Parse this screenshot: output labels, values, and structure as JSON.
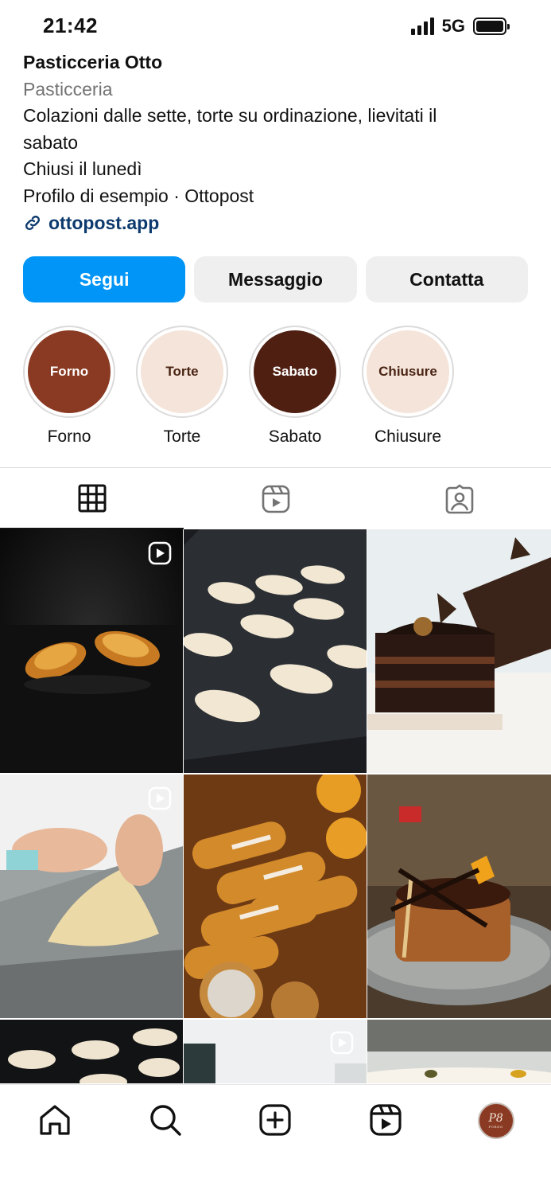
{
  "status_bar": {
    "time": "21:42",
    "network": "5G"
  },
  "profile": {
    "name": "Pasticceria Otto",
    "category": "Pasticceria",
    "bio_lines": [
      "Colazioni dalle sette, torte su ordinazione, lievitati il",
      "sabato",
      "Chiusi il lunedì",
      "Profilo di esempio · Ottopost"
    ],
    "link": "ottopost.app",
    "link_icon": "link-icon"
  },
  "actions": {
    "follow": "Segui",
    "message": "Messaggio",
    "contact": "Contatta"
  },
  "highlights": [
    {
      "title": "Forno",
      "label": "Forno",
      "bg": "#8a3a22",
      "fg": "#ffffff"
    },
    {
      "title": "Torte",
      "label": "Torte",
      "bg": "#f4e4d9",
      "fg": "#4a2414"
    },
    {
      "title": "Sabato",
      "label": "Sabato",
      "bg": "#4f1f12",
      "fg": "#ffffff"
    },
    {
      "title": "Chiusure",
      "label": "Chiusure",
      "bg": "#f4e4d9",
      "fg": "#4a2414"
    }
  ],
  "tabs": [
    "grid-icon",
    "reels-icon",
    "tagged-icon"
  ],
  "posts": [
    {
      "subject": "croissants-on-black",
      "reel": true
    },
    {
      "subject": "raw-croissants-on-tray",
      "reel": false
    },
    {
      "subject": "chocolate-cake-slices",
      "reel": false
    },
    {
      "subject": "kneading-dough",
      "reel": true
    },
    {
      "subject": "eclairs-display",
      "reel": false
    },
    {
      "subject": "chocolate-tartlet",
      "reel": false
    },
    {
      "subject": "croissants-on-tray",
      "reel": false
    },
    {
      "subject": "bakery-scene",
      "reel": true
    },
    {
      "subject": "dessert-plate",
      "reel": false
    }
  ],
  "bottom_nav": [
    "home-icon",
    "search-icon",
    "create-icon",
    "reels-icon",
    "profile-avatar"
  ],
  "avatar": {
    "initials": "P8",
    "sub": "FORNO"
  },
  "colors": {
    "accent": "#0095f6",
    "link": "#0d3a6e",
    "secondary_text": "#737373",
    "button_bg": "#efefef"
  }
}
